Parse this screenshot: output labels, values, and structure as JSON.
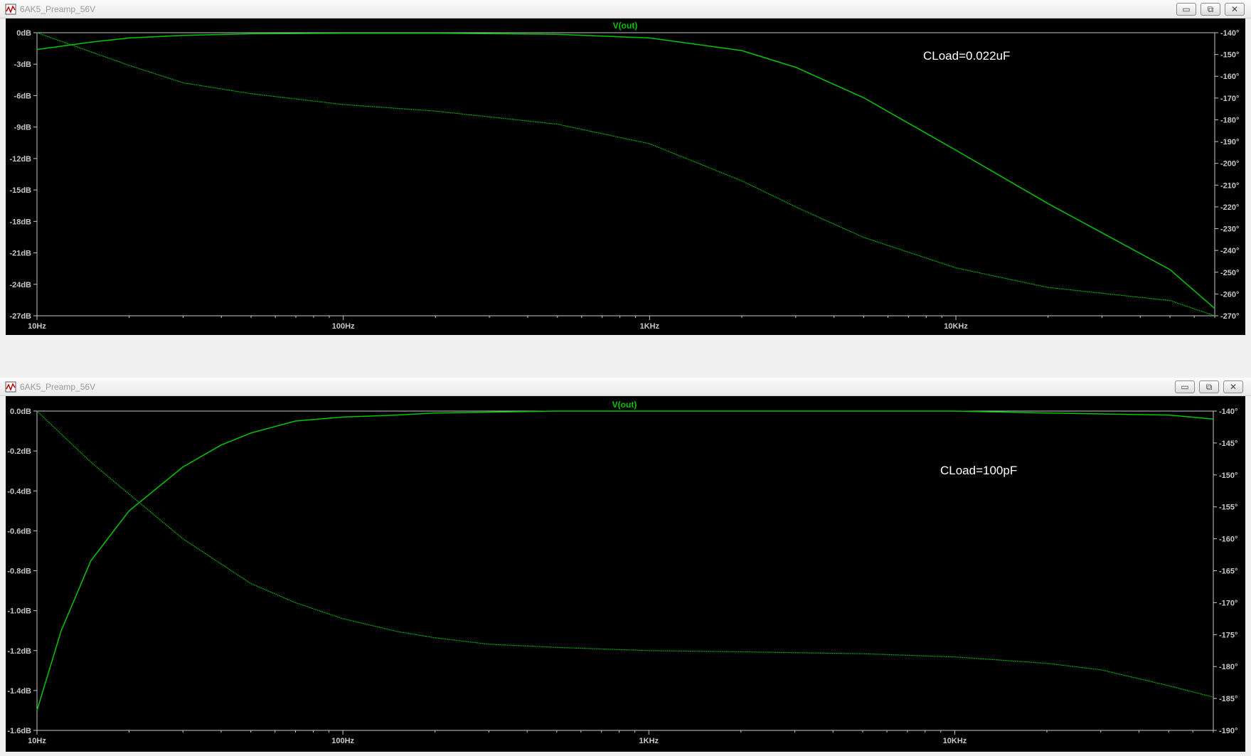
{
  "windows": [
    {
      "title": "6AK5_Preamp_56V",
      "trace_label": "V(out)",
      "annotation": "CLoad=0.022uF",
      "y_left_ticks": [
        "0dB",
        "-3dB",
        "-6dB",
        "-9dB",
        "-12dB",
        "-15dB",
        "-18dB",
        "-21dB",
        "-24dB",
        "-27dB"
      ],
      "y_right_ticks": [
        "-140°",
        "-150°",
        "-160°",
        "-170°",
        "-180°",
        "-190°",
        "-200°",
        "-210°",
        "-220°",
        "-230°",
        "-240°",
        "-250°",
        "-260°",
        "-270°"
      ],
      "x_ticks": [
        "10Hz",
        "100Hz",
        "1KHz",
        "10KHz"
      ],
      "buttons": {
        "minimize": "▭",
        "restore": "⧉",
        "close": "✕"
      }
    },
    {
      "title": "6AK5_Preamp_56V",
      "trace_label": "V(out)",
      "annotation": "CLoad=100pF",
      "y_left_ticks": [
        "0.0dB",
        "-0.2dB",
        "-0.4dB",
        "-0.6dB",
        "-0.8dB",
        "-1.0dB",
        "-1.2dB",
        "-1.4dB",
        "-1.6dB"
      ],
      "y_right_ticks": [
        "-140°",
        "-145°",
        "-150°",
        "-155°",
        "-160°",
        "-165°",
        "-170°",
        "-175°",
        "-180°",
        "-185°",
        "-190°"
      ],
      "x_ticks": [
        "10Hz",
        "100Hz",
        "1KHz",
        "10KHz"
      ],
      "buttons": {
        "minimize": "▭",
        "restore": "⧉",
        "close": "✕"
      }
    }
  ],
  "colors": {
    "background": "#000000",
    "grid": "#c8c8c8",
    "trace": "#00c800",
    "label_text": "#c8c8c8",
    "annotation_text": "#ffffff"
  },
  "chart_data": [
    {
      "type": "line",
      "x_scale": "log",
      "xlim": [
        10,
        70000
      ],
      "ylim_left": [
        -27,
        0
      ],
      "ylim_right": [
        -270,
        -140
      ],
      "series": [
        {
          "name": "V(out)",
          "axis": "left",
          "x": [
            10,
            15,
            20,
            30,
            50,
            100,
            200,
            500,
            1000,
            2000,
            3000,
            5000,
            10000,
            20000,
            50000,
            70000
          ],
          "values": [
            -1.6,
            -0.9,
            -0.5,
            -0.25,
            -0.1,
            -0.05,
            -0.05,
            -0.15,
            -0.5,
            -1.7,
            -3.3,
            -6.2,
            -11.2,
            -16.3,
            -22.6,
            -26.3
          ]
        },
        {
          "name": "",
          "axis": "right",
          "x": [
            10,
            20,
            30,
            50,
            100,
            200,
            500,
            1000,
            2000,
            3000,
            5000,
            10000,
            20000,
            50000,
            70000
          ],
          "values": [
            -140,
            -155,
            -163,
            -168,
            -173,
            -176,
            -182,
            -191,
            -208,
            -220,
            -234,
            -248,
            -257,
            -263,
            -270
          ]
        }
      ]
    },
    {
      "type": "line",
      "x_scale": "log",
      "xlim": [
        10,
        70000
      ],
      "ylim_left": [
        -1.6,
        0
      ],
      "ylim_right": [
        -190,
        -140
      ],
      "series": [
        {
          "name": "V(out)",
          "axis": "left",
          "x": [
            10,
            12,
            15,
            20,
            30,
            40,
            50,
            70,
            100,
            150,
            200,
            500,
            1000,
            5000,
            10000,
            20000,
            50000,
            70000
          ],
          "values": [
            -1.5,
            -1.1,
            -0.75,
            -0.5,
            -0.28,
            -0.17,
            -0.11,
            -0.05,
            -0.03,
            -0.02,
            -0.01,
            0,
            0,
            0,
            0,
            -0.01,
            -0.02,
            -0.04
          ]
        },
        {
          "name": "",
          "axis": "right",
          "x": [
            10,
            15,
            20,
            30,
            50,
            70,
            100,
            150,
            200,
            300,
            500,
            1000,
            2000,
            5000,
            10000,
            20000,
            30000,
            50000,
            70000
          ],
          "values": [
            -140,
            -148,
            -153,
            -160,
            -167,
            -170,
            -172.5,
            -174.5,
            -175.5,
            -176.5,
            -177,
            -177.5,
            -177.7,
            -178,
            -178.5,
            -179.5,
            -180.5,
            -183,
            -184.8
          ]
        }
      ]
    }
  ]
}
